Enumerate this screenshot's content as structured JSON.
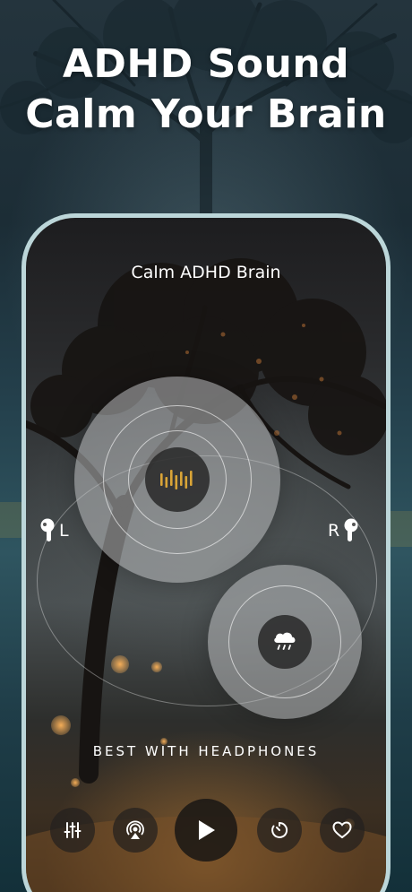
{
  "headline": {
    "line1": "ADHD Sound",
    "line2": "Calm Your Brain"
  },
  "player": {
    "track_title": "Calm ADHD Brain",
    "left_channel": "L",
    "right_channel": "R",
    "tagline": "BEST WITH HEADPHONES",
    "main_orb_icon": "sound-wave-icon",
    "secondary_orb_icon": "rain-cloud-icon"
  },
  "controls": [
    {
      "name": "mixer-button",
      "icon": "sliders-icon"
    },
    {
      "name": "airplay-button",
      "icon": "airplay-icon"
    },
    {
      "name": "play-button",
      "icon": "play-icon"
    },
    {
      "name": "timer-button",
      "icon": "timer-icon"
    },
    {
      "name": "favorite-button",
      "icon": "heart-icon"
    }
  ],
  "colors": {
    "accent": "#d9a437",
    "frame": "#bcd6d9",
    "text": "#ffffff"
  }
}
